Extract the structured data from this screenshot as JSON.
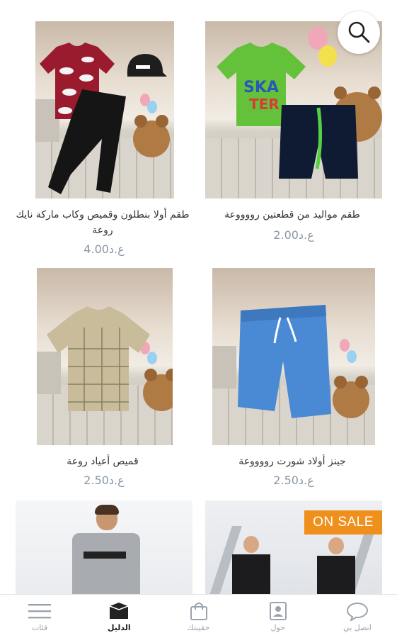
{
  "products": [
    {
      "title": "طقم مواليد من قطعتين رووووعة",
      "price": "2.00ع.د",
      "image": "boys-green-skater-tshirt-and-navy-shorts"
    },
    {
      "title": "طقم أولا بنطلون وقميص وكاب ماركة نايك روعة",
      "price": "4.00ع.د",
      "image": "red-print-shirt-black-joggers-and-cap"
    },
    {
      "title": "جينز أولاد شورت رووووعة",
      "price": "2.50ع.د",
      "image": "blue-denim-shorts"
    },
    {
      "title": "قميص أعياد روعة",
      "price": "2.50ع.د",
      "image": "beige-checked-polo-shirt"
    },
    {
      "title": "",
      "price": "",
      "image": "two-boys-in-black-tshirts",
      "badge": "ON SALE"
    },
    {
      "title": "",
      "price": "",
      "image": "boy-in-grey-tshirt"
    }
  ],
  "search": {
    "icon": "search-icon"
  },
  "tabbar": {
    "tabs": [
      {
        "label": "اتصل بي",
        "icon": "chat-bubble-icon",
        "active": false
      },
      {
        "label": "حول",
        "icon": "contact-card-icon",
        "active": false
      },
      {
        "label": "حقيبتك",
        "icon": "shopping-bag-icon",
        "active": false
      },
      {
        "label": "الدليل",
        "icon": "catalog-box-icon",
        "active": true
      },
      {
        "label": "فئات",
        "icon": "menu-icon",
        "active": false
      }
    ]
  },
  "colors": {
    "accent": "#f0901c",
    "price": "#8a96a3",
    "tab_inactive": "#9aa4ae"
  }
}
